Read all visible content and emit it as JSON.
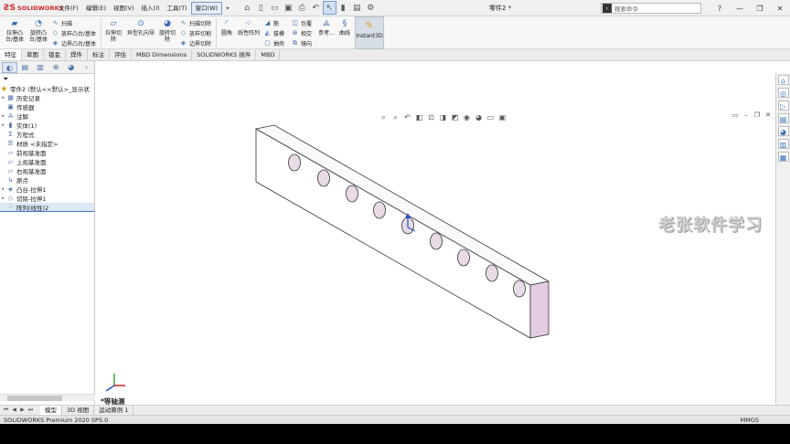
{
  "app": {
    "logo": "SOLIDWORKS",
    "document_title": "零件2 *"
  },
  "menu": [
    "文件(F)",
    "编辑(E)",
    "视图(V)",
    "插入(I)",
    "工具(T)",
    "窗口(W)"
  ],
  "search": {
    "placeholder": "搜索命令"
  },
  "ribbon": {
    "extrude_boss": "拉伸凸\n台/基体",
    "revolve_boss": "旋转凸\n台/基体",
    "sweep": "扫描",
    "loft": "放样凸台/基体",
    "boundary_boss": "边界凸台/基体",
    "extrude_cut": "拉伸切\n除",
    "hole_wizard": "异型孔向导",
    "revolve_cut": "旋转切\n除",
    "sweep_cut": "扫描切除",
    "loft_cut": "放样切割",
    "boundary_cut": "边界切除",
    "fillet": "圆角",
    "linear_pattern": "线性阵列",
    "rib": "筋",
    "draft": "拔模",
    "shell": "抽壳",
    "wrap": "包覆",
    "intersect": "相交",
    "mirror": "镜向",
    "reference": "参考...",
    "curves": "曲线",
    "instant3d": "Instant3D"
  },
  "tabs": [
    "特征",
    "草图",
    "钣金",
    "焊件",
    "标注",
    "评估",
    "MBD Dimensions",
    "SOLIDWORKS 插件",
    "MBD"
  ],
  "tree": {
    "root": "零件2 (默认<<默认>_显示状",
    "items": [
      {
        "label": "历史记录",
        "expand": "▸"
      },
      {
        "label": "传感器",
        "expand": ""
      },
      {
        "label": "注解",
        "expand": "▸"
      },
      {
        "label": "实体(1)",
        "expand": "▸"
      },
      {
        "label": "方程式",
        "expand": ""
      },
      {
        "label": "材质 <未指定>",
        "expand": ""
      },
      {
        "label": "前视基准面",
        "expand": ""
      },
      {
        "label": "上视基准面",
        "expand": ""
      },
      {
        "label": "右视基准面",
        "expand": ""
      },
      {
        "label": "原点",
        "expand": ""
      },
      {
        "label": "凸台-拉伸1",
        "expand": "▸"
      },
      {
        "label": "切除-拉伸1",
        "expand": "▸"
      },
      {
        "label": "阵列(线性)2",
        "expand": ""
      }
    ]
  },
  "viewport": {
    "watermark": "老张软件学习",
    "view_label": "*等轴测"
  },
  "bottom_tabs": [
    "模型",
    "3D 视图",
    "运动算例 1"
  ],
  "status": {
    "left": "SOLIDWORKS Premium 2020 SP5.0",
    "units": "MMGS"
  },
  "colors": {
    "brand": "#d2232a",
    "hole_fill": "#e8dbe6",
    "end_face": "#e3cde1"
  }
}
